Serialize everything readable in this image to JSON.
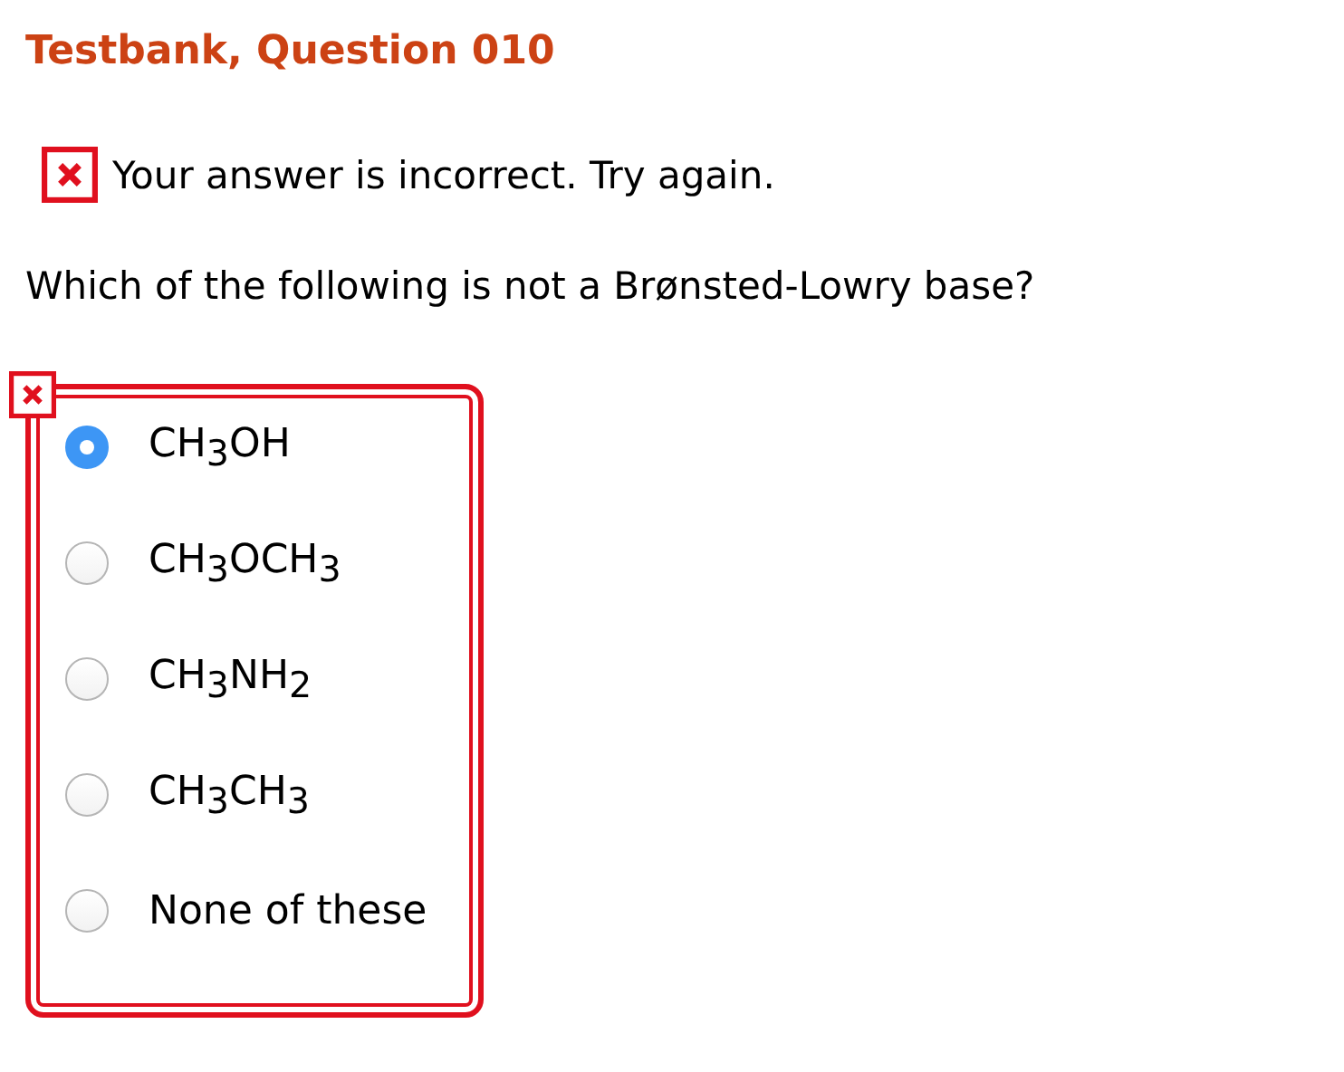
{
  "title": "Testbank, Question 010",
  "feedback": {
    "correct": false,
    "text": "Your answer is incorrect.  Try again."
  },
  "question": "Which of the following is not a Brønsted-Lowry base?",
  "answers": {
    "correct": false,
    "options": [
      {
        "label": "CH$_{3}$OH",
        "selected": true
      },
      {
        "label": "CH$_{3}$OCH$_{3}$",
        "selected": false
      },
      {
        "label": "CH$_{3}$NH$_{2}$",
        "selected": false
      },
      {
        "label": "CH$_{3}$CH$_{3}$",
        "selected": false
      },
      {
        "label": "None of these",
        "selected": false
      }
    ]
  }
}
